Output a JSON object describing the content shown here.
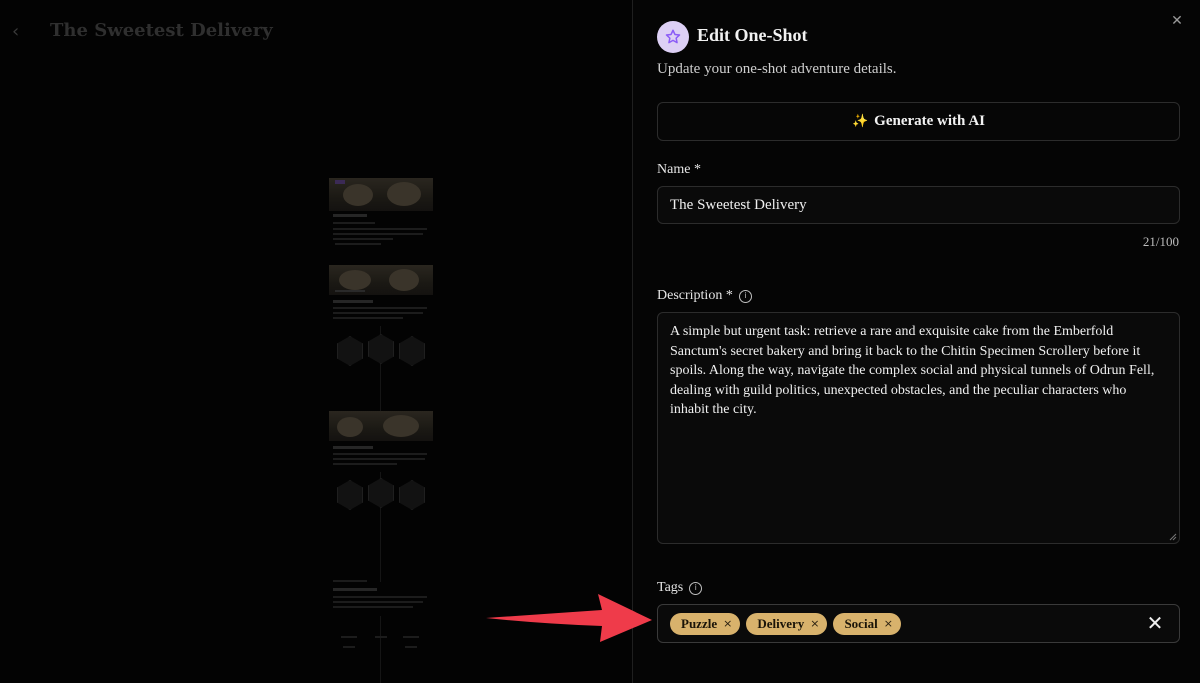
{
  "background_page": {
    "back_icon": "chevron-left-icon",
    "title": "The Sweetest Delivery"
  },
  "panel": {
    "close_icon": "close-icon",
    "header": {
      "icon": "star-icon",
      "title": "Edit One-Shot",
      "subtitle": "Update your one-shot adventure details."
    },
    "generate_button": {
      "icon": "sparkles-icon",
      "spark": "✨",
      "label": "Generate with AI"
    },
    "name_field": {
      "label": "Name",
      "required_mark": "*",
      "value": "The Sweetest Delivery",
      "counter": "21/100"
    },
    "description_field": {
      "label": "Description",
      "required_mark": "*",
      "info_icon": "info-icon",
      "value": "A simple but urgent task: retrieve a rare and exquisite cake from the Emberfold Sanctum's secret bakery and bring it back to the Chitin Specimen Scrollery before it spoils. Along the way, navigate the complex social and physical tunnels of Odrun Fell, dealing with guild politics, unexpected obstacles, and the peculiar characters who inhabit the city."
    },
    "tags_field": {
      "label": "Tags",
      "info_icon": "info-icon",
      "tags": [
        {
          "label": "Puzzle",
          "remove": "×"
        },
        {
          "label": "Delivery",
          "remove": "×"
        },
        {
          "label": "Social",
          "remove": "×"
        }
      ],
      "clear_icon": "close-icon"
    }
  },
  "annotation": {
    "arrow_color": "#ef3b4a"
  },
  "colors": {
    "tag_chip": "#d8b26c",
    "header_icon_bg": "#ddd0f5",
    "star_stroke": "#8b5cf6",
    "panel_bg": "#050505"
  }
}
